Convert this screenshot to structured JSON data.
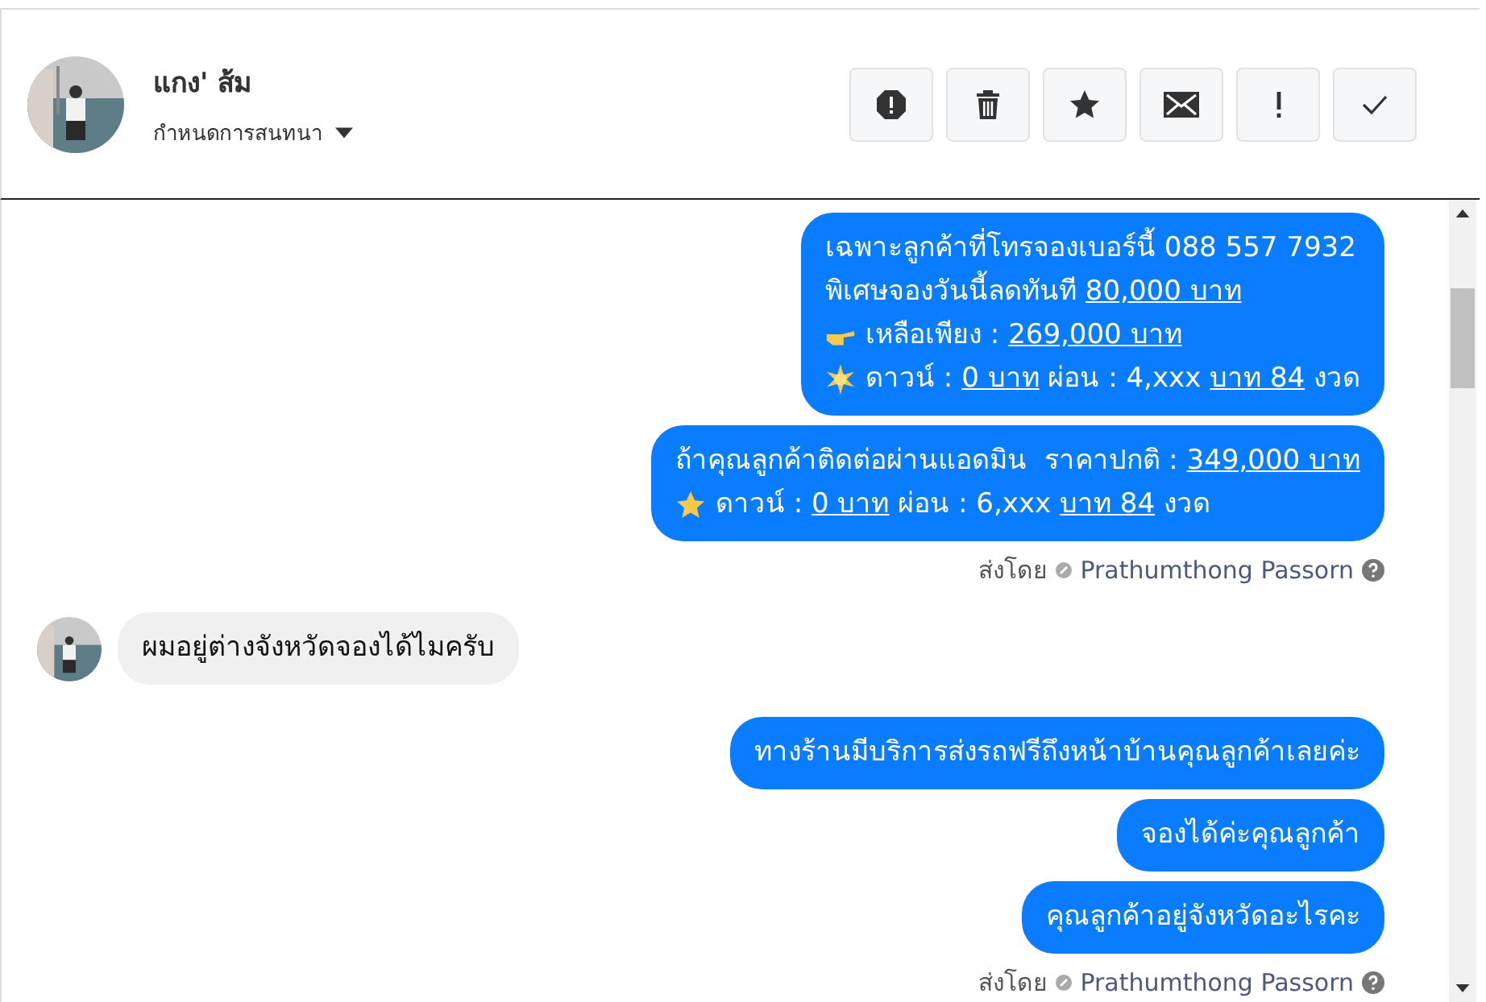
{
  "header": {
    "name": "แกง' ส้ม",
    "menu_label": "กำหนดการสนทนา",
    "buttons": [
      {
        "kind": "alert"
      },
      {
        "kind": "trash"
      },
      {
        "kind": "star"
      },
      {
        "kind": "mail"
      },
      {
        "kind": "exclaim"
      },
      {
        "kind": "check"
      }
    ]
  },
  "messages": [
    {
      "kind": "outgoing",
      "lines": [
        [
          {
            "text": "เฉพาะลูกค้าที่โทรจองเบอร์นี้ 088 557 7932"
          }
        ],
        [
          {
            "text": "พิเศษจองวันนี้ลดทันที "
          },
          {
            "text": "80,000 บาท",
            "link": true
          }
        ],
        [
          {
            "kind": "emoji"
          },
          {
            "text": "เหลือเพียง : "
          },
          {
            "text": "269,000 บาท",
            "link": true
          }
        ],
        [
          {
            "kind": "emoji"
          },
          {
            "text": "ดาวน์ : "
          },
          {
            "text": "0 บาท",
            "link": true
          },
          {
            "text": " ผ่อน : 4,xxx "
          },
          {
            "text": "บาท 84",
            "link": true
          },
          {
            "text": " งวด"
          }
        ]
      ]
    },
    {
      "kind": "outgoing",
      "lines": [
        [
          {
            "text": "ถ้าคุณลูกค้าติดต่อผ่านแอดมิน  ราคาปกติ : "
          },
          {
            "text": "349,000 บาท",
            "link": true
          }
        ],
        [
          {
            "kind": "emoji"
          },
          {
            "text": "ดาวน์ : "
          },
          {
            "text": "0 บาท",
            "link": true
          },
          {
            "text": " ผ่อน : 6,xxx "
          },
          {
            "text": "บาท 84",
            "link": true
          },
          {
            "text": " งวด"
          }
        ]
      ]
    },
    {
      "kind": "sender",
      "label": "ส่งโดย",
      "name": "Prathumthong Passorn"
    },
    {
      "kind": "incoming",
      "lines": [
        [
          {
            "text": "ผมอยู่ต่างจังหวัดจองได้ไมครับ"
          }
        ]
      ]
    },
    {
      "kind": "outgoing",
      "lines": [
        [
          {
            "text": "ทางร้านมีบริการส่งรถฟรีถึงหน้าบ้านคุณลูกค้าเลยค่ะ"
          }
        ]
      ]
    },
    {
      "kind": "outgoing",
      "lines": [
        [
          {
            "text": "จองได้ค่ะคุณลูกค้า"
          }
        ]
      ]
    },
    {
      "kind": "outgoing",
      "lines": [
        [
          {
            "text": "คุณลูกค้าอยู่จังหวัดอะไรคะ"
          }
        ]
      ]
    },
    {
      "kind": "sender",
      "label": "ส่งโดย",
      "name": "Prathumthong Passorn"
    }
  ]
}
